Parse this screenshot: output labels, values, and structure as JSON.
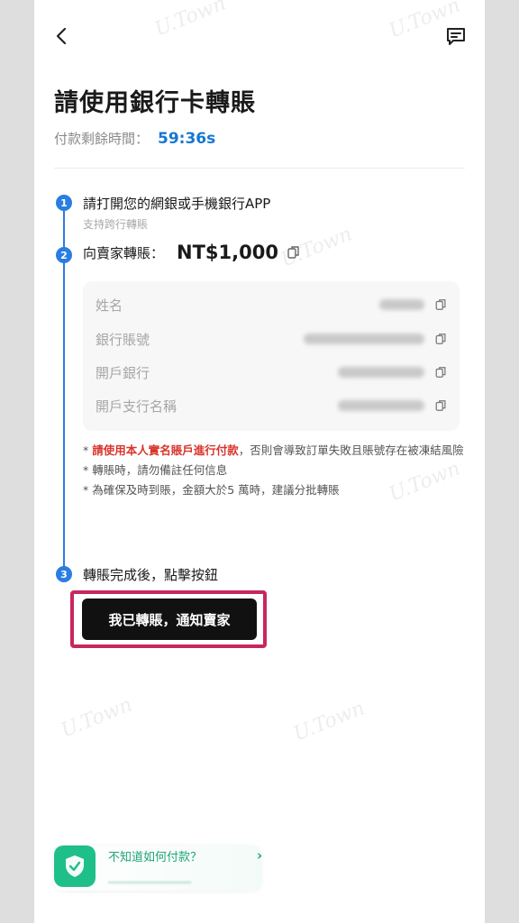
{
  "header": {
    "title": "請使用銀行卡轉賬"
  },
  "timer": {
    "label": "付款剩餘時間：",
    "value": "59:36s"
  },
  "steps": [
    {
      "num": "1",
      "title": "請打開您的網銀或手機銀行APP",
      "sub": "支持跨行轉賬"
    },
    {
      "num": "2",
      "title": "向賣家轉賬：",
      "amount": "NT$1,000"
    },
    {
      "num": "3",
      "title": "轉賬完成後，點擊按鈕"
    }
  ],
  "account_info": [
    {
      "label": "姓名"
    },
    {
      "label": "銀行賬號"
    },
    {
      "label": "開戶銀行"
    },
    {
      "label": "開戶支行名稱"
    }
  ],
  "notes": {
    "line1_red": "請使用本人實名賬戶進行付款",
    "line1_rest": "，否則會導致訂單失敗且賬號存在被凍結風險",
    "line2": "轉賬時，請勿備註任何信息",
    "line3": "為確保及時到賬，金額大於5 萬時，建議分批轉賬"
  },
  "cta": {
    "label": "我已轉賬，通知賣家"
  },
  "help": {
    "text": "不知道如何付款？",
    "arrow": "›"
  },
  "watermark": "U.Town",
  "colors": {
    "accent_blue": "#2a7de1",
    "timer_blue": "#1677d2",
    "warn_red": "#d9342b",
    "highlight": "#c8265f",
    "help_green": "#1fbf8a"
  }
}
